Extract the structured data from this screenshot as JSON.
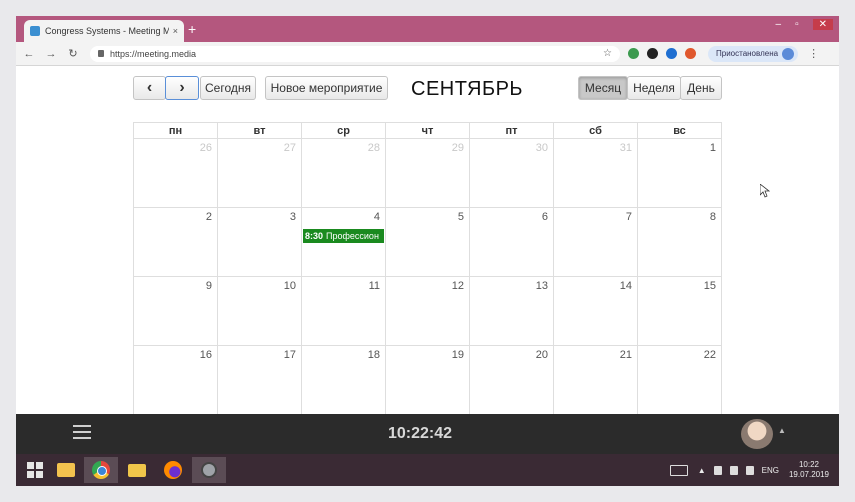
{
  "browser": {
    "tab_title": "Congress Systems - Meeting Me",
    "tab_close": "×",
    "new_tab": "+",
    "url": "https://meeting.media",
    "profile_label": "Приостановлена",
    "back": "←",
    "forward": "→",
    "reload": "↻",
    "star": "☆",
    "menu": "⋮",
    "win_minimize": "–",
    "win_maximize": "▫",
    "win_close": "✕",
    "extension_colors": [
      "#3c9a4f",
      "#222222",
      "#1f6fd1",
      "#e0582d"
    ]
  },
  "calendar": {
    "prev_label": "‹",
    "next_label": "›",
    "today_label": "Сегодня",
    "new_event_label": "Новое мероприятие",
    "month_title": "СЕНТЯБРЬ",
    "view_month": "Месяц",
    "view_week": "Неделя",
    "view_day": "День",
    "active_view": "Месяц",
    "weekdays": [
      "пн",
      "вт",
      "ср",
      "чт",
      "пт",
      "сб",
      "вс"
    ],
    "weeks": [
      [
        {
          "d": "26",
          "o": true
        },
        {
          "d": "27",
          "o": true
        },
        {
          "d": "28",
          "o": true
        },
        {
          "d": "29",
          "o": true
        },
        {
          "d": "30",
          "o": true
        },
        {
          "d": "31",
          "o": true
        },
        {
          "d": "1",
          "o": false
        }
      ],
      [
        {
          "d": "2",
          "o": false
        },
        {
          "d": "3",
          "o": false
        },
        {
          "d": "4",
          "o": false
        },
        {
          "d": "5",
          "o": false
        },
        {
          "d": "6",
          "o": false
        },
        {
          "d": "7",
          "o": false
        },
        {
          "d": "8",
          "o": false
        }
      ],
      [
        {
          "d": "9",
          "o": false
        },
        {
          "d": "10",
          "o": false
        },
        {
          "d": "11",
          "o": false
        },
        {
          "d": "12",
          "o": false
        },
        {
          "d": "13",
          "o": false
        },
        {
          "d": "14",
          "o": false
        },
        {
          "d": "15",
          "o": false
        }
      ],
      [
        {
          "d": "16",
          "o": false
        },
        {
          "d": "17",
          "o": false
        },
        {
          "d": "18",
          "o": false
        },
        {
          "d": "19",
          "o": false
        },
        {
          "d": "20",
          "o": false
        },
        {
          "d": "21",
          "o": false
        },
        {
          "d": "22",
          "o": false
        }
      ]
    ],
    "event": {
      "week": 1,
      "day": 2,
      "time": "8:30",
      "title": "Профессион",
      "color": "#1a8a1f"
    }
  },
  "conference": {
    "clock": "10:22:42"
  },
  "taskbar": {
    "lang": "ENG",
    "time": "10:22",
    "date": "19.07.2019"
  }
}
